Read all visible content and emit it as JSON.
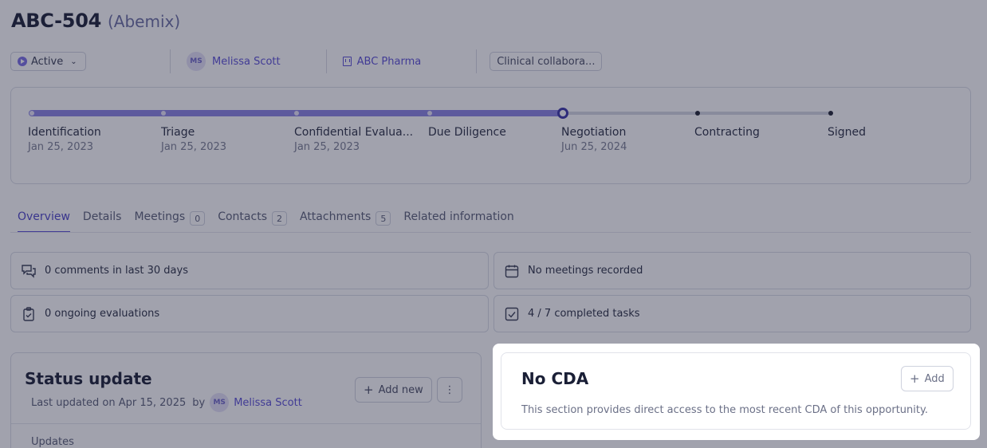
{
  "header": {
    "title": "ABC-504",
    "subtitle": "(Abemix)"
  },
  "meta": {
    "status": "Active",
    "owner_initials": "MS",
    "owner_name": "Melissa Scott",
    "company": "ABC Pharma",
    "category": "Clinical collabora..."
  },
  "pipeline": {
    "stages": [
      {
        "name": "Identification",
        "date": "Jan 25, 2023",
        "state": "done"
      },
      {
        "name": "Triage",
        "date": "Jan 25, 2023",
        "state": "done"
      },
      {
        "name": "Confidential Evalua...",
        "date": "Jan 25, 2023",
        "state": "done"
      },
      {
        "name": "Due Diligence",
        "date": "",
        "state": "done"
      },
      {
        "name": "Negotiation",
        "date": "Jun 25, 2024",
        "state": "current"
      },
      {
        "name": "Contracting",
        "date": "",
        "state": "todo"
      },
      {
        "name": "Signed",
        "date": "",
        "state": "todo"
      }
    ]
  },
  "tabs": [
    {
      "label": "Overview",
      "count": ""
    },
    {
      "label": "Details",
      "count": ""
    },
    {
      "label": "Meetings",
      "count": "0"
    },
    {
      "label": "Contacts",
      "count": "2"
    },
    {
      "label": "Attachments",
      "count": "5"
    },
    {
      "label": "Related information",
      "count": ""
    }
  ],
  "summary": {
    "comments": "0 comments in last 30 days",
    "meetings": "No meetings recorded",
    "evaluations": "0 ongoing evaluations",
    "tasks": "4 / 7 completed tasks"
  },
  "status_update": {
    "title": "Status update",
    "last_updated": "Last updated on Apr 15, 2025",
    "by": "by",
    "author_initials": "MS",
    "author": "Melissa Scott",
    "add_new": "Add new",
    "more": "⋮",
    "updates_label": "Updates"
  },
  "cda": {
    "title": "No CDA",
    "add_label": "Add",
    "description": "This section provides direct access to the most recent CDA of this opportunity."
  },
  "colors": {
    "accent": "#5a4fd6",
    "progress": "#8a84e3",
    "overlay": "rgba(30,34,60,0.42)"
  }
}
